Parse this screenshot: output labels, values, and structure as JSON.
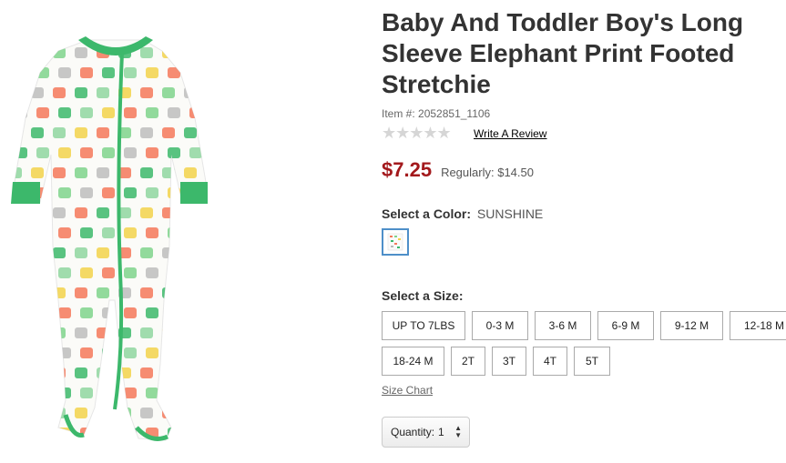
{
  "product": {
    "title_line1": "Baby And Toddler Boy's Long",
    "title_line2": "Sleeve Elephant Print Footed",
    "title_line3": "Stretchie",
    "item_label": "Item #:",
    "item_number": "2052851_1106",
    "rating_stars": "★★★★★",
    "review_link": "Write A Review"
  },
  "pricing": {
    "sale_price": "$7.25",
    "regular_label": "Regularly:",
    "regular_price": "$14.50",
    "sale_color": "#a3191c"
  },
  "color": {
    "label": "Select a Color:",
    "selected": "SUNSHINE"
  },
  "sizes": {
    "label": "Select a Size:",
    "row1": [
      "UP TO 7LBS",
      "0-3 M",
      "3-6 M",
      "6-9 M",
      "9-12 M",
      "12-18 M"
    ],
    "row2": [
      "18-24 M",
      "2T",
      "3T",
      "4T",
      "5T"
    ],
    "chart_link": "Size Chart"
  },
  "quantity": {
    "label": "Quantity:",
    "value": "1"
  },
  "icons": {
    "product": "elephant-print-footed-stretchie",
    "stars": "star-rating-icon",
    "dropdown": "select-arrows-icon"
  }
}
